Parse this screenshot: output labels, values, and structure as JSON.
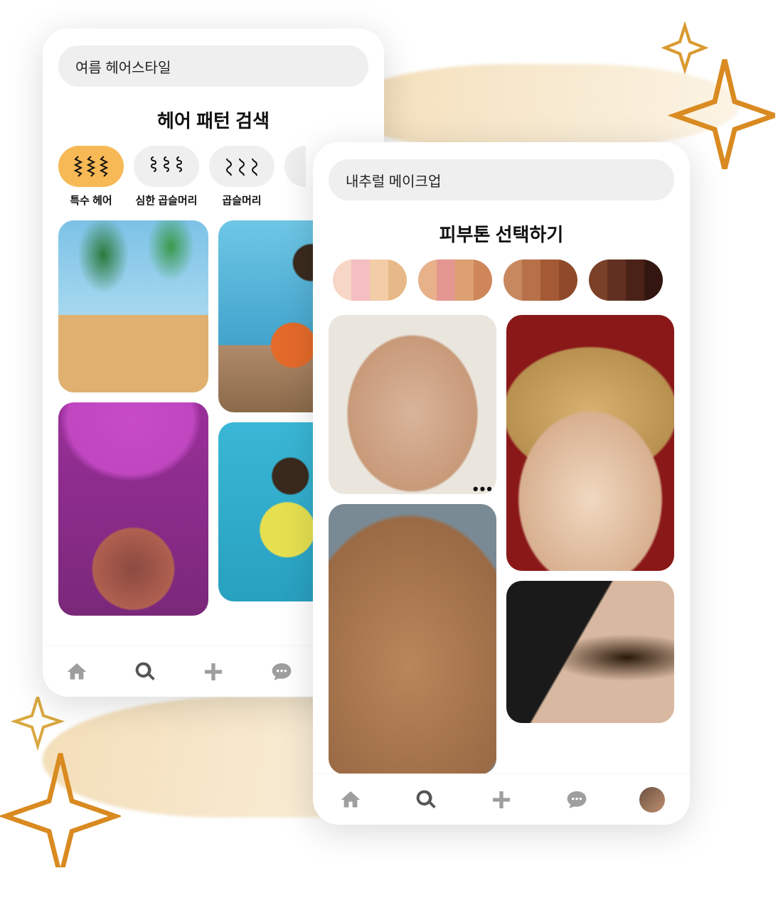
{
  "phone_left": {
    "search_value": "여름 헤어스타일",
    "section_title": "헤어 패턴 검색",
    "chips": [
      {
        "label": "특수 헤어",
        "active": true,
        "icon": "braid-icon"
      },
      {
        "label": "심한 곱슬머리",
        "active": false,
        "icon": "tight-curl-icon"
      },
      {
        "label": "곱슬머리",
        "active": false,
        "icon": "curl-icon"
      }
    ],
    "images": [
      {
        "name": "palm-trees-photo",
        "klass": "palm"
      },
      {
        "name": "purple-flowers-photo",
        "klass": "flowers"
      },
      {
        "name": "dreadlocks-photo",
        "klass": "dread"
      },
      {
        "name": "pool-braids-photo",
        "klass": "pool"
      }
    ]
  },
  "phone_right": {
    "search_value": "내추럴 메이크업",
    "section_title": "피부톤 선택하기",
    "tones": [
      [
        "#f7d6c6",
        "#f5bec0",
        "#f2cda8",
        "#e8b988"
      ],
      [
        "#e7b18a",
        "#e49690",
        "#dca072",
        "#cf875a"
      ],
      [
        "#c78860",
        "#b87048",
        "#a45a34",
        "#8e4a2a"
      ],
      [
        "#7a4028",
        "#613020",
        "#4a2218",
        "#331610"
      ]
    ],
    "images": [
      {
        "name": "bald-smile-photo",
        "klass": "bald"
      },
      {
        "name": "freckles-closeup-photo",
        "klass": "freckles"
      },
      {
        "name": "red-background-photo",
        "klass": "redbg"
      },
      {
        "name": "eyebrow-closeup-photo",
        "klass": "brow"
      }
    ]
  },
  "nav": {
    "items": [
      "home",
      "search",
      "add",
      "chat",
      "profile"
    ]
  },
  "more_dots": "•••"
}
